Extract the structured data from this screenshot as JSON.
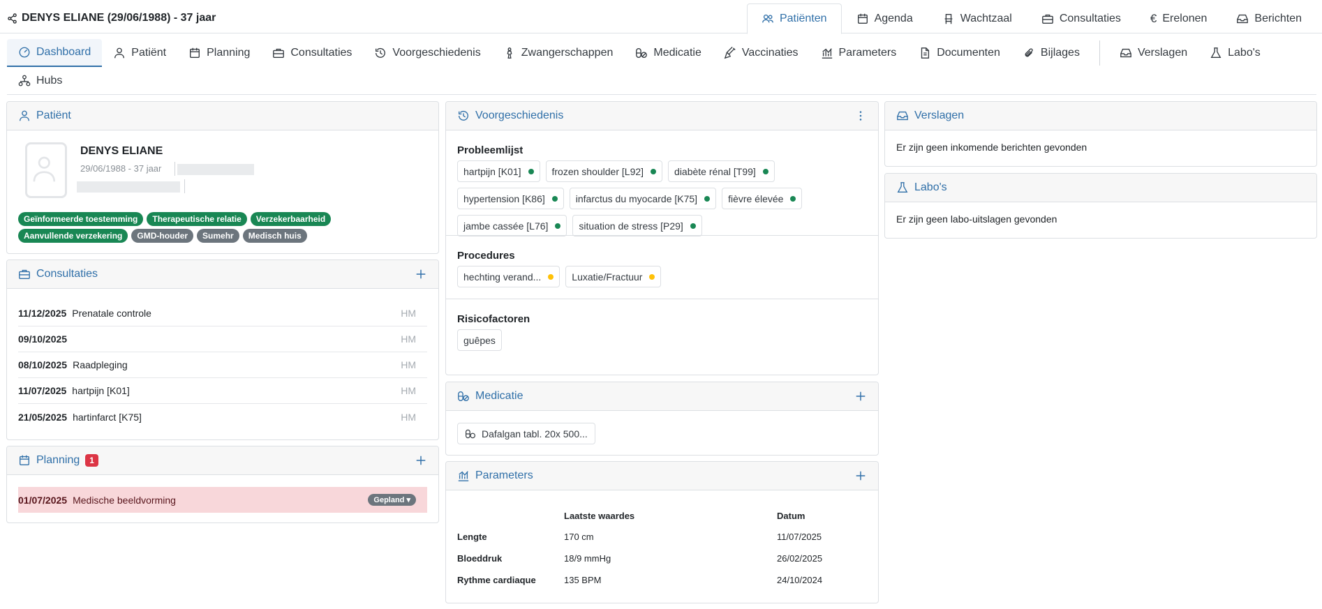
{
  "patient_title": "DENYS ELIANE (29/06/1988) - 37 jaar",
  "top_tabs": [
    {
      "label": "Patiënten",
      "icon": "users-icon"
    },
    {
      "label": "Agenda",
      "icon": "calendar-icon"
    },
    {
      "label": "Wachtzaal",
      "icon": "chair-icon"
    },
    {
      "label": "Consultaties",
      "icon": "briefcase-icon"
    },
    {
      "label": "Erelonen",
      "icon": "euro-icon"
    },
    {
      "label": "Berichten",
      "icon": "inbox-icon"
    }
  ],
  "nav": [
    {
      "label": "Dashboard",
      "icon": "dashboard-icon"
    },
    {
      "label": "Patiënt",
      "icon": "person-icon"
    },
    {
      "label": "Planning",
      "icon": "calendar-icon"
    },
    {
      "label": "Consultaties",
      "icon": "briefcase-icon"
    },
    {
      "label": "Voorgeschiedenis",
      "icon": "history-icon"
    },
    {
      "label": "Zwangerschappen",
      "icon": "pregnancy-icon"
    },
    {
      "label": "Medicatie",
      "icon": "pills-icon"
    },
    {
      "label": "Vaccinaties",
      "icon": "syringe-icon"
    },
    {
      "label": "Parameters",
      "icon": "chart-icon"
    },
    {
      "label": "Documenten",
      "icon": "document-icon"
    },
    {
      "label": "Bijlages",
      "icon": "paperclip-icon"
    },
    {
      "label": "Verslagen",
      "icon": "inbox-icon"
    },
    {
      "label": "Labo's",
      "icon": "flask-icon"
    },
    {
      "label": "Hubs",
      "icon": "hubs-icon"
    }
  ],
  "patient_card": {
    "title": "Patiënt",
    "name": "DENYS ELIANE",
    "dob": "29/06/1988 - 37 jaar",
    "tags_row1": [
      {
        "label": "Geïnformeerde toestemming",
        "color": "#198754"
      },
      {
        "label": "Therapeutische relatie",
        "color": "#198754"
      },
      {
        "label": "Verzekerbaarheid",
        "color": "#198754"
      }
    ],
    "tags_row2": [
      {
        "label": "Aanvullende verzekering",
        "color": "#198754"
      },
      {
        "label": "GMD-houder",
        "color": "#6c757d"
      },
      {
        "label": "Sumehr",
        "color": "#6c757d"
      },
      {
        "label": "Medisch huis",
        "color": "#6c757d"
      }
    ]
  },
  "consultaties": {
    "title": "Consultaties",
    "rows": [
      {
        "date": "11/12/2025",
        "desc": "Prenatale controle",
        "who": "HM"
      },
      {
        "date": "09/10/2025",
        "desc": "",
        "who": "HM"
      },
      {
        "date": "08/10/2025",
        "desc": "Raadpleging",
        "who": "HM"
      },
      {
        "date": "11/07/2025",
        "desc": "hartpijn [K01]",
        "who": "HM"
      },
      {
        "date": "21/05/2025",
        "desc": "hartinfarct [K75]",
        "who": "HM"
      }
    ]
  },
  "planning": {
    "title": "Planning",
    "badge": "1",
    "rows": [
      {
        "date": "01/07/2025",
        "desc": "Medische beeldvorming",
        "status": "Gepland"
      }
    ]
  },
  "voorgeschiedenis": {
    "title": "Voorgeschiedenis",
    "probleemlijst_title": "Probleemlijst",
    "probleemlijst": [
      "hartpijn [K01]",
      "frozen shoulder [L92]",
      "diabète rénal [T99]",
      "hypertension [K86]",
      "infarctus du myocarde [K75]",
      "fièvre élevée",
      "jambe cassée [L76]",
      "situation de stress [P29]"
    ],
    "procedures_title": "Procedures",
    "procedures": [
      "hechting verand...",
      "Luxatie/Fractuur"
    ],
    "risicofactoren_title": "Risicofactoren",
    "risicofactoren": [
      "guêpes"
    ]
  },
  "medicatie": {
    "title": "Medicatie",
    "items": [
      "Dafalgan tabl. 20x 500..."
    ]
  },
  "parameters": {
    "title": "Parameters",
    "col_value": "Laatste waardes",
    "col_date": "Datum",
    "rows": [
      {
        "label": "Lengte",
        "value": "170 cm",
        "date": "11/07/2025"
      },
      {
        "label": "Bloeddruk",
        "value": "18/9 mmHg",
        "date": "26/02/2025"
      },
      {
        "label": "Rythme cardiaque",
        "value": "135 BPM",
        "date": "24/10/2024"
      }
    ]
  },
  "verslagen": {
    "title": "Verslagen",
    "empty": "Er zijn geen inkomende berichten gevonden"
  },
  "labos": {
    "title": "Labo's",
    "empty": "Er zijn geen labo-uitslagen gevonden"
  },
  "colors": {
    "accent": "#2f6fa8",
    "green": "#198754",
    "gray": "#6c757d",
    "danger": "#dc3545",
    "planning_row": "#f8d7da"
  }
}
